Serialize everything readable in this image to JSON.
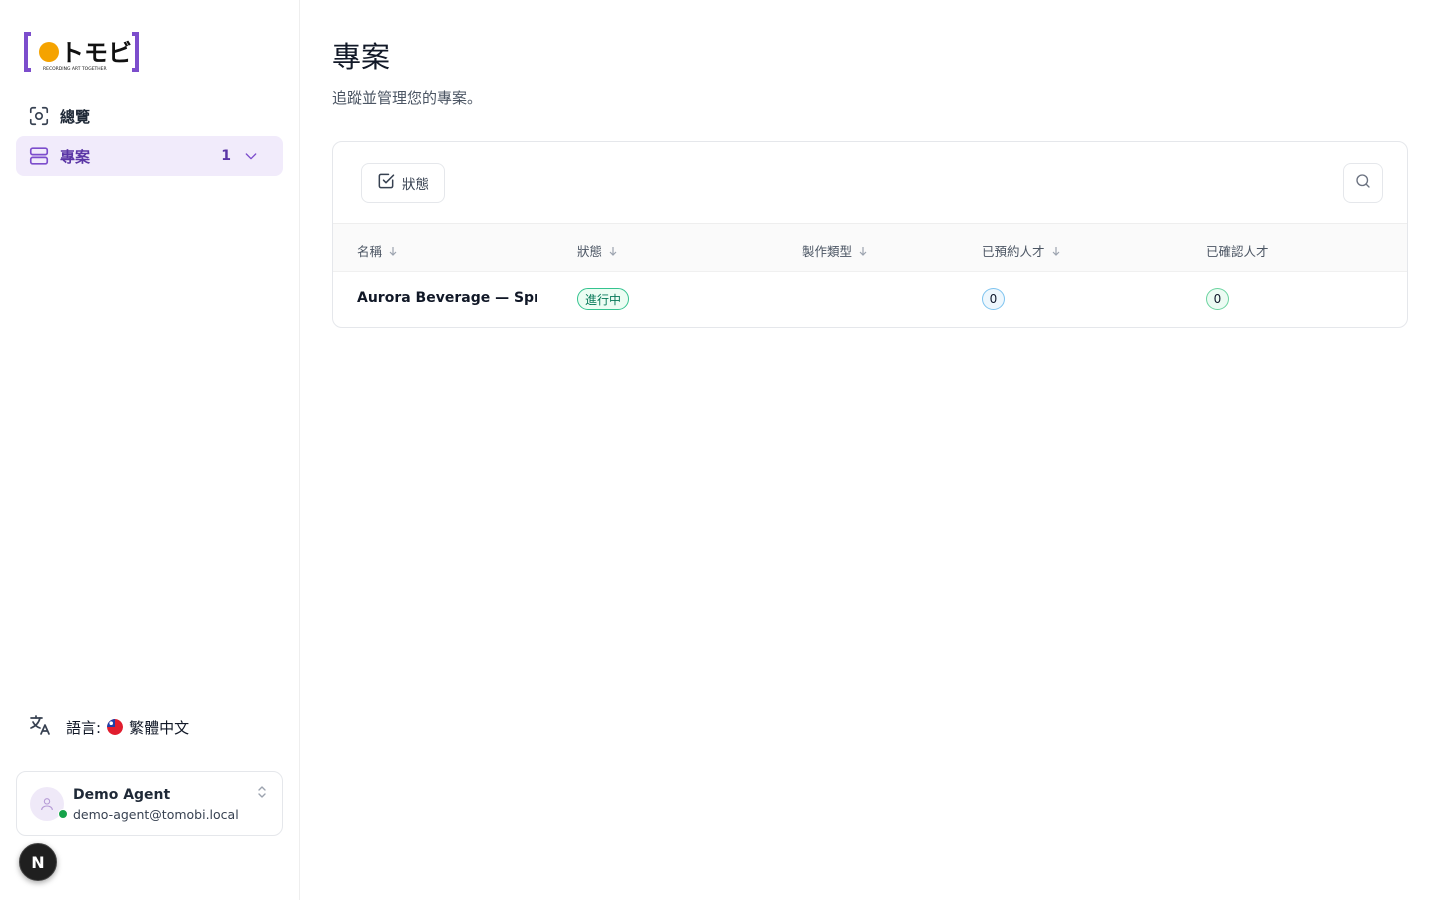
{
  "brand": {
    "logo_text": "トモビ",
    "logo_tagline": "RECORDING ART TOGETHER",
    "accent_color": "#7c4dcc",
    "dot_color": "#f5a300"
  },
  "sidebar": {
    "items": [
      {
        "label": "總覽",
        "icon": "scan-eye-icon",
        "active": false
      },
      {
        "label": "專案",
        "icon": "rows-icon",
        "active": true,
        "count": "1"
      }
    ],
    "language": {
      "label": "語言:",
      "value": "繁體中文",
      "icon": "translate-icon",
      "flag": "taiwan-flag"
    },
    "user": {
      "name": "Demo Agent",
      "email": "demo-agent@tomobi.local",
      "status": "online"
    },
    "dev_badge": "N"
  },
  "main": {
    "title": "專案",
    "subtitle": "追蹤並管理您的專案。",
    "toolbar": {
      "filter_label": "狀態"
    },
    "table": {
      "columns": [
        {
          "label": "名稱",
          "sortable": true
        },
        {
          "label": "狀態",
          "sortable": true
        },
        {
          "label": "製作類型",
          "sortable": true
        },
        {
          "label": "已預約人才",
          "sortable": true
        },
        {
          "label": "已確認人才",
          "sortable": false
        }
      ],
      "rows": [
        {
          "name": "Aurora Beverage — Spr...",
          "status": "進行中",
          "production_type": "",
          "booked_talent": "0",
          "confirmed_talent": "0"
        }
      ]
    }
  }
}
